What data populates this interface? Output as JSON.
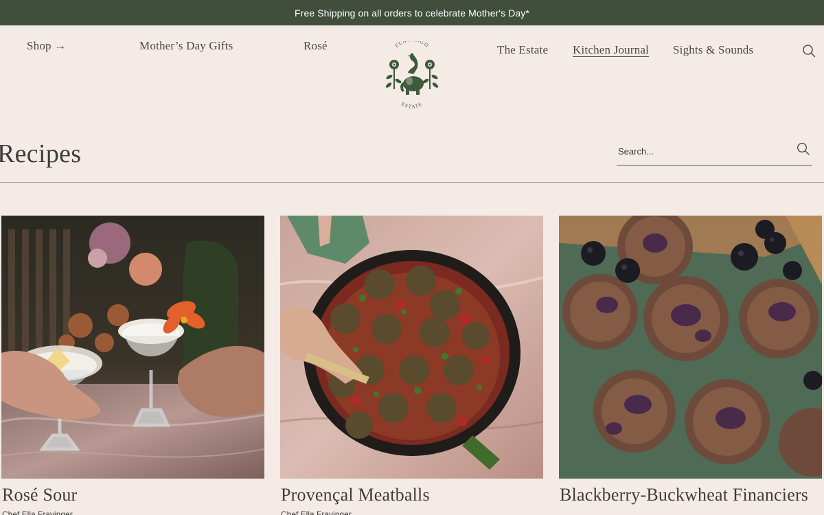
{
  "promo": {
    "text": "Free Shipping on all orders to celebrate Mother's Day*"
  },
  "nav": {
    "shop": "Shop →",
    "mothers_day": "Mother’s Day Gifts",
    "rose": "Rosé",
    "estate": "The Estate",
    "kitchen_journal": "Kitchen Journal",
    "sights_sounds": "Sights & Sounds"
  },
  "logo": {
    "top_text": "FLAMINGO",
    "bottom_text": "ESTATE"
  },
  "page": {
    "title": "Recipes"
  },
  "search": {
    "placeholder": "Search..."
  },
  "recipes": [
    {
      "title": "Rosé Sour",
      "author": "Chef Ella Fravinger"
    },
    {
      "title": "Provençal Meatballs",
      "author": "Chef Ella Fravinger"
    },
    {
      "title": "Blackberry-Buckwheat Financiers",
      "author": ""
    }
  ],
  "colors": {
    "promo_bg": "#414e3b",
    "page_bg": "#f4ebe6",
    "logo": "#3f5a3c",
    "text": "#3d3d3d"
  },
  "icons": {
    "search": "search-icon",
    "logo": "flamingo-elephant-logo"
  }
}
